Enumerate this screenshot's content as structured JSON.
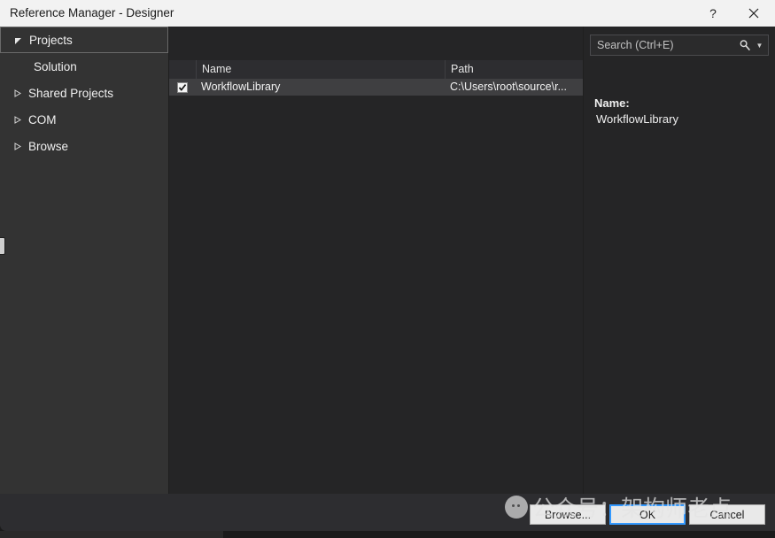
{
  "window": {
    "title": "Reference Manager - Designer",
    "help_icon": "question-mark-icon",
    "close_icon": "close-icon"
  },
  "sidebar": {
    "items": [
      {
        "label": "Projects",
        "expanded": true,
        "selected": true,
        "level": 0,
        "has_twisty": true
      },
      {
        "label": "Solution",
        "expanded": false,
        "selected": false,
        "level": 1,
        "has_twisty": false
      },
      {
        "label": "Shared Projects",
        "expanded": false,
        "selected": false,
        "level": 0,
        "has_twisty": true
      },
      {
        "label": "COM",
        "expanded": false,
        "selected": false,
        "level": 0,
        "has_twisty": true
      },
      {
        "label": "Browse",
        "expanded": false,
        "selected": false,
        "level": 0,
        "has_twisty": true
      }
    ]
  },
  "list": {
    "columns": [
      "",
      "Name",
      "Path"
    ],
    "rows": [
      {
        "checked": true,
        "name": "WorkflowLibrary",
        "path": "C:\\Users\\root\\source\\r...",
        "selected": true
      }
    ]
  },
  "detail": {
    "search": {
      "placeholder": "Search (Ctrl+E)",
      "value": "",
      "icon": "search-icon",
      "caret_icon": "chevron-down-icon"
    },
    "name_label": "Name:",
    "name_value": "WorkflowLibrary"
  },
  "footer": {
    "browse_label": "Browse...",
    "ok_label": "OK",
    "cancel_label": "Cancel"
  },
  "watermark": {
    "text": "公众号：架构师老点",
    "logo": "wechat-logo-icon"
  },
  "colors": {
    "titlebar_bg": "#f2f2f2",
    "sidebar_bg": "#333333",
    "list_bg": "#252526",
    "row_selected": "#3f3f41",
    "header_bg": "#2d2d30",
    "focus_blue": "#3399ff",
    "text": "#f0f0f0"
  }
}
